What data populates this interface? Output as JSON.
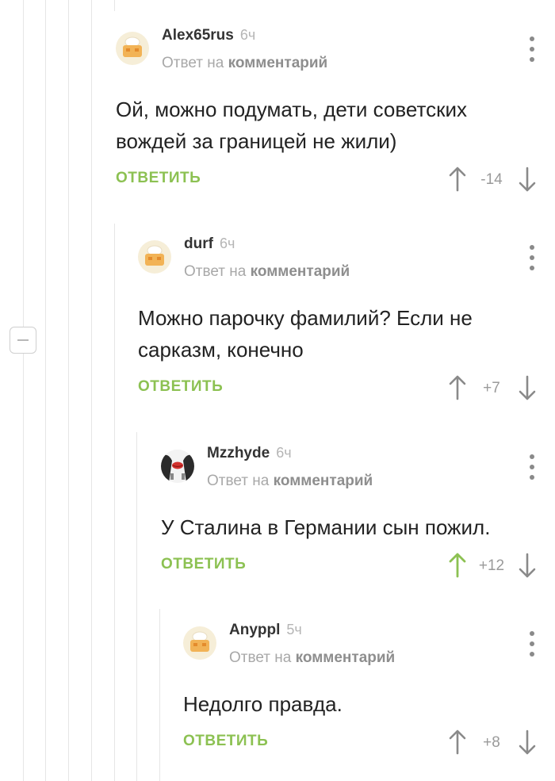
{
  "comments": [
    {
      "author": "Alex65rus",
      "time": "6ч",
      "reply_prefix": "Ответ на",
      "reply_link": "комментарий",
      "text_lines": [
        "Ой, можно подумать, дети советских",
        "вождей за границей не жили)"
      ],
      "reply_label": "ответить",
      "score": "-14",
      "upvoted": false,
      "avatar_icon": "default-chef-avatar"
    },
    {
      "author": "durf",
      "time": "6ч",
      "reply_prefix": "Ответ на",
      "reply_link": "комментарий",
      "text_lines": [
        "Можно парочку фамилий? Если не",
        "сарказм, конечно"
      ],
      "reply_label": "ответить",
      "score": "+7",
      "upvoted": false,
      "avatar_icon": "default-chef-avatar"
    },
    {
      "author": "Mzzhyde",
      "time": "6ч",
      "reply_prefix": "Ответ на",
      "reply_link": "комментарий",
      "text_lines": [
        "У Сталина в Германии сын пожил."
      ],
      "reply_label": "ответить",
      "score": "+12",
      "upvoted": true,
      "avatar_icon": "user-photo-avatar"
    },
    {
      "author": "Anyppl",
      "time": "5ч",
      "reply_prefix": "Ответ на",
      "reply_link": "комментарий",
      "text_lines": [
        "Недолго правда."
      ],
      "reply_label": "ответить",
      "score": "+8",
      "upvoted": false,
      "avatar_icon": "default-chef-avatar"
    }
  ],
  "colors": {
    "accent_green": "#8cc152",
    "vote_gray": "#8a8a8a",
    "thread_line": "#e6e6e6"
  }
}
